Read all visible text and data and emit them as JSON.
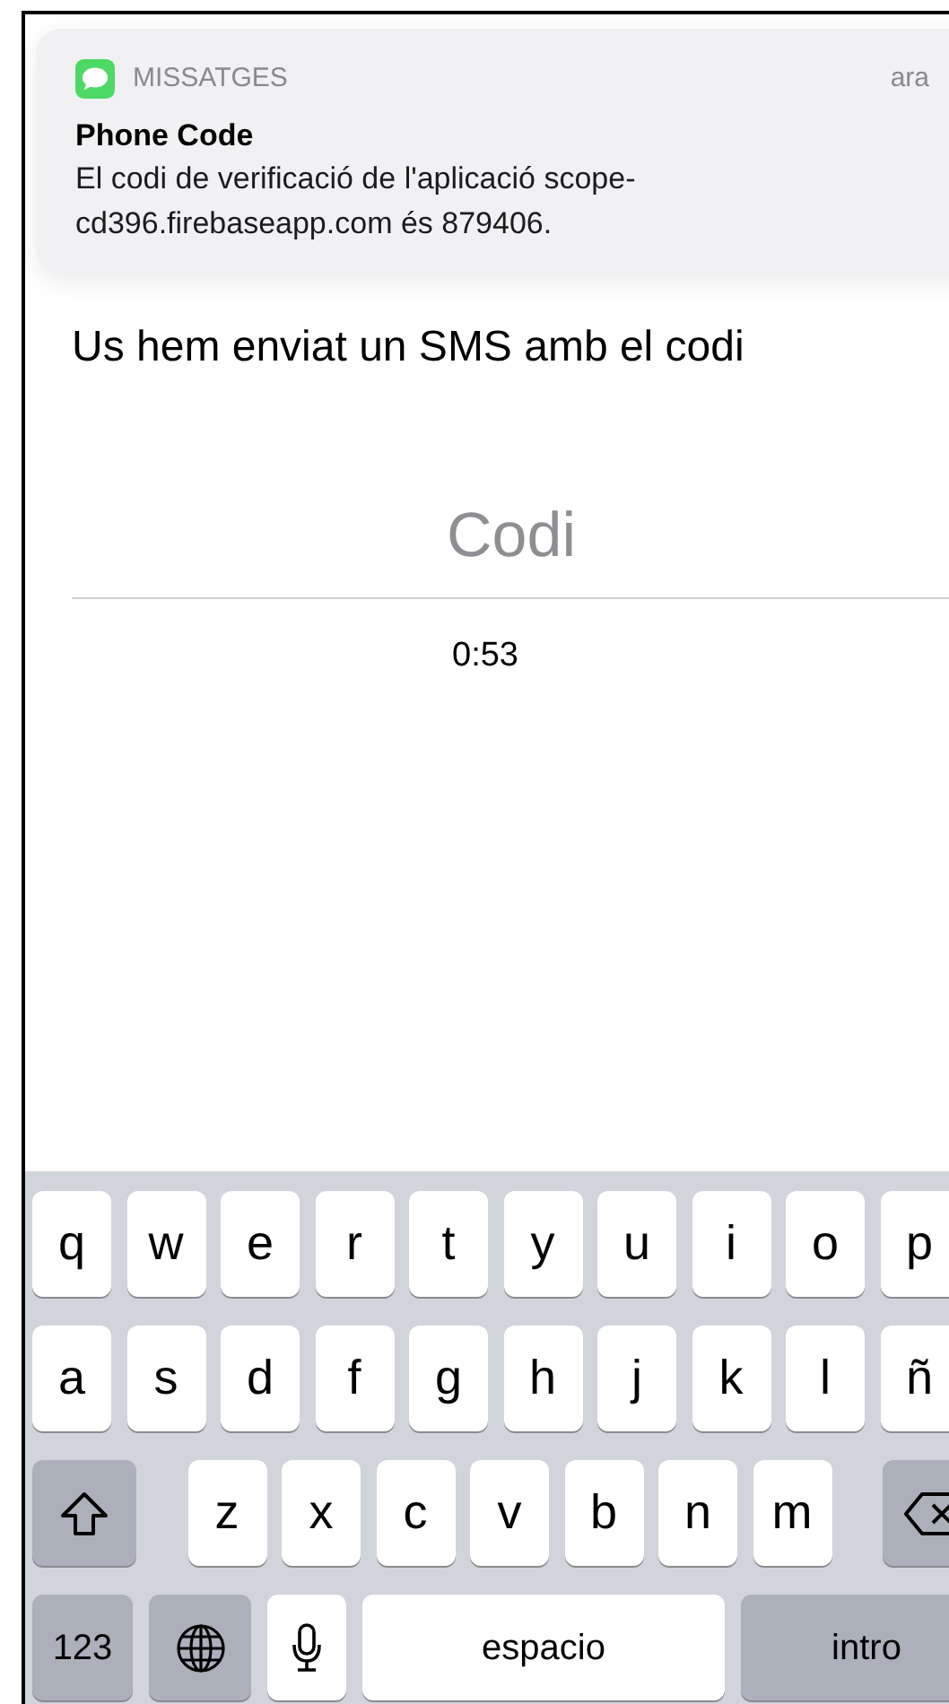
{
  "notification": {
    "app": "MISSATGES",
    "time": "ara",
    "title": "Phone Code",
    "body": "El codi de verificació de l'aplicació scope-cd396.firebaseapp.com és 879406."
  },
  "heading": "Us hem enviat un SMS amb el codi",
  "code_field": {
    "placeholder": "Codi"
  },
  "timer": "0:53",
  "keyboard": {
    "letter_rows": [
      [
        {
          "kind": "letter",
          "label": "q"
        },
        {
          "kind": "letter",
          "label": "w"
        },
        {
          "kind": "letter",
          "label": "e"
        },
        {
          "kind": "letter",
          "label": "r"
        },
        {
          "kind": "letter",
          "label": "t"
        },
        {
          "kind": "letter",
          "label": "y"
        },
        {
          "kind": "letter",
          "label": "u"
        },
        {
          "kind": "letter",
          "label": "i"
        },
        {
          "kind": "letter",
          "label": "o"
        },
        {
          "kind": "letter",
          "label": "p"
        }
      ],
      [
        {
          "kind": "letter",
          "label": "a"
        },
        {
          "kind": "letter",
          "label": "s"
        },
        {
          "kind": "letter",
          "label": "d"
        },
        {
          "kind": "letter",
          "label": "f"
        },
        {
          "kind": "letter",
          "label": "g"
        },
        {
          "kind": "letter",
          "label": "h"
        },
        {
          "kind": "letter",
          "label": "j"
        },
        {
          "kind": "letter",
          "label": "k"
        },
        {
          "kind": "letter",
          "label": "l"
        },
        {
          "kind": "letter",
          "label": "ñ"
        }
      ],
      [
        {
          "kind": "shift"
        },
        {
          "kind": "letter",
          "label": "z"
        },
        {
          "kind": "letter",
          "label": "x"
        },
        {
          "kind": "letter",
          "label": "c"
        },
        {
          "kind": "letter",
          "label": "v"
        },
        {
          "kind": "letter",
          "label": "b"
        },
        {
          "kind": "letter",
          "label": "n"
        },
        {
          "kind": "letter",
          "label": "m"
        },
        {
          "kind": "backspace"
        }
      ]
    ],
    "bottom_bar": [
      {
        "kind": "numbers",
        "label": "123"
      },
      {
        "kind": "globe"
      },
      {
        "kind": "mic"
      },
      {
        "kind": "space",
        "label": "espacio"
      },
      {
        "kind": "return",
        "label": "intro"
      }
    ]
  }
}
